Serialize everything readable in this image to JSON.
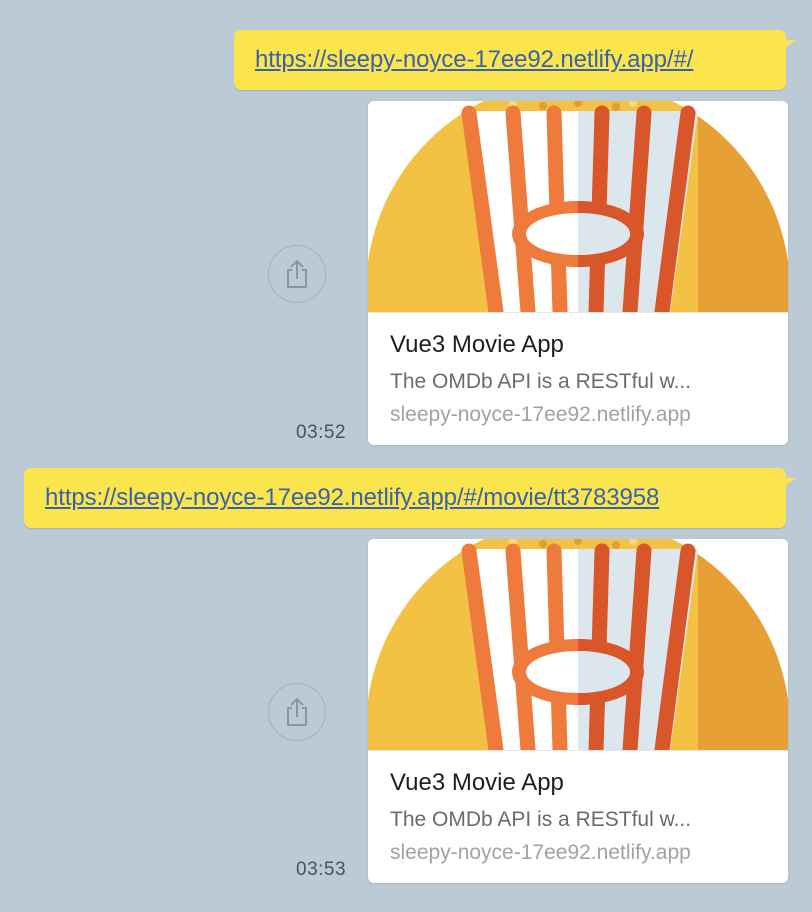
{
  "messages": [
    {
      "link": "https://sleepy-noyce-17ee92.netlify.app/#/",
      "preview": {
        "title": "Vue3 Movie App",
        "description": "The OMDb API is a RESTful w...",
        "domain": "sleepy-noyce-17ee92.netlify.app"
      },
      "time": "03:52"
    },
    {
      "link": "https://sleepy-noyce-17ee92.netlify.app/#/movie/tt3783958",
      "preview": {
        "title": "Vue3 Movie App",
        "description": "The OMDb API is a RESTful w...",
        "domain": "sleepy-noyce-17ee92.netlify.app"
      },
      "time": "03:53"
    }
  ],
  "icons": {
    "share": "share-icon",
    "thumbnail": "popcorn-icon"
  },
  "colors": {
    "background": "#bccad6",
    "bubble": "#fbe54f",
    "link": "#3a62a8"
  }
}
